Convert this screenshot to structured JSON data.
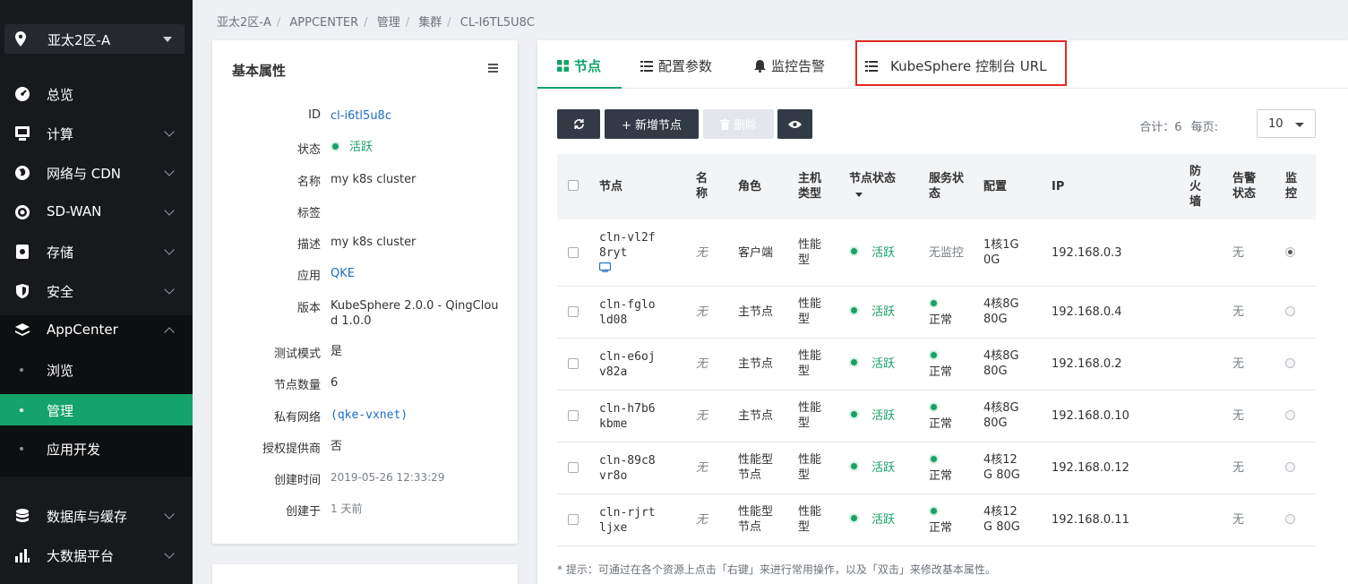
{
  "sidebar": {
    "region": "亚太2区-A",
    "items": [
      {
        "label": "总览",
        "icon": "speedometer-icon"
      },
      {
        "label": "计算",
        "icon": "monitor-icon"
      },
      {
        "label": "网络与 CDN",
        "icon": "globe-icon"
      },
      {
        "label": "SD-WAN",
        "icon": "sdwan-icon"
      },
      {
        "label": "存储",
        "icon": "storage-icon"
      },
      {
        "label": "安全",
        "icon": "shield-icon"
      },
      {
        "label": "AppCenter",
        "icon": "layers-icon"
      },
      {
        "label": "数据库与缓存",
        "icon": "database-icon"
      },
      {
        "label": "大数据平台",
        "icon": "bar-chart-icon"
      }
    ],
    "appcenter_sub": [
      "浏览",
      "管理",
      "应用开发"
    ]
  },
  "breadcrumb": [
    "亚太2区-A",
    "APPCENTER",
    "管理",
    "集群",
    "CL-I6TL5U8C"
  ],
  "properties": {
    "title": "基本属性",
    "rows": [
      {
        "key": "ID",
        "value": "cl-i6tl5u8c"
      },
      {
        "key": "状态",
        "value": "活跃"
      },
      {
        "key": "名称",
        "value": "my k8s cluster"
      },
      {
        "key": "标签",
        "value": ""
      },
      {
        "key": "描述",
        "value": "my k8s cluster"
      },
      {
        "key": "应用",
        "value": "QKE"
      },
      {
        "key": "版本",
        "value": "KubeSphere 2.0.0 - QingCloud 1.0.0"
      },
      {
        "key": "测试模式",
        "value": "是"
      },
      {
        "key": "节点数量",
        "value": "6"
      },
      {
        "key": "私有网络",
        "value": "(qke-vxnet)"
      },
      {
        "key": "授权提供商",
        "value": "否"
      },
      {
        "key": "创建时间",
        "value": "2019-05-26 12:33:29"
      },
      {
        "key": "创建于",
        "value": "1 天前"
      }
    ]
  },
  "tabs": [
    "节点",
    "配置参数",
    "监控告警",
    "KubeSphere 控制台 URL"
  ],
  "toolbar": {
    "add_label": "+ 新增节点",
    "delete_label": "删除",
    "total": "合计：6",
    "per_page_label": "每页:",
    "per_page": "10"
  },
  "table": {
    "headers": {
      "node": "节点",
      "name": "名称",
      "role": "角色",
      "host_type": "主机类型",
      "node_status": "节点状态",
      "service_status": "服务状态",
      "config": "配置",
      "ip": "IP",
      "firewall": "防火墙",
      "alarm": "告警状态",
      "monitor": "监控"
    },
    "rows": [
      {
        "node": "cln-vl2f8ryt",
        "name": "无",
        "role": "客户端",
        "host_type": "性能型",
        "node_status": "活跃",
        "service_status": "无监控",
        "config": "1核1G 0G",
        "ip": "192.168.0.3",
        "alarm": "无"
      },
      {
        "node": "cln-fglold08",
        "name": "无",
        "role": "主节点",
        "host_type": "性能型",
        "node_status": "活跃",
        "service_status": "正常",
        "config": "4核8G 80G",
        "ip": "192.168.0.4",
        "alarm": "无"
      },
      {
        "node": "cln-e6ojv82a",
        "name": "无",
        "role": "主节点",
        "host_type": "性能型",
        "node_status": "活跃",
        "service_status": "正常",
        "config": "4核8G 80G",
        "ip": "192.168.0.2",
        "alarm": "无"
      },
      {
        "node": "cln-h7b6kbme",
        "name": "无",
        "role": "主节点",
        "host_type": "性能型",
        "node_status": "活跃",
        "service_status": "正常",
        "config": "4核8G 80G",
        "ip": "192.168.0.10",
        "alarm": "无"
      },
      {
        "node": "cln-89c8vr8o",
        "name": "无",
        "role": "性能型节点",
        "host_type": "性能型",
        "node_status": "活跃",
        "service_status": "正常",
        "config": "4核12G 80G",
        "ip": "192.168.0.12",
        "alarm": "无"
      },
      {
        "node": "cln-rjrtljxe",
        "name": "无",
        "role": "性能型节点",
        "host_type": "性能型",
        "node_status": "活跃",
        "service_status": "正常",
        "config": "4核12G 80G",
        "ip": "192.168.0.11",
        "alarm": "无"
      }
    ]
  },
  "tip": "* 提示：可通过在各个资源上点击「右键」来进行常用操作，以及「双击」来修改基本属性。",
  "colors": {
    "accent": "#14a36b",
    "sidebar": "#17191d",
    "link": "#1d6ec3",
    "highlight": "#e02b20"
  }
}
